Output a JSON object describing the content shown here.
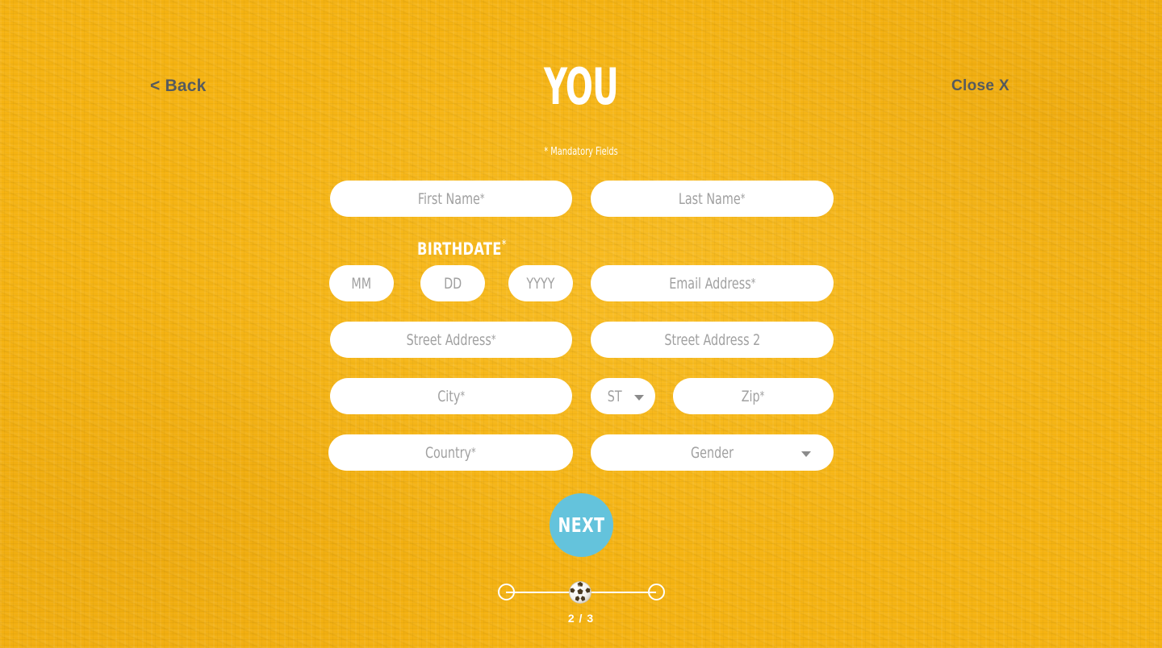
{
  "theme": {
    "background_color": "#f5b312",
    "field_background": "#ffffff",
    "placeholder_color": "#a0a0a0",
    "link_color": "#555a5e",
    "accent_color": "#64c3dc",
    "text_on_accent": "#ffffff"
  },
  "header": {
    "back_label": "< Back",
    "title": "YOU",
    "close_label": "Close X"
  },
  "form": {
    "mandatory_note": "* Mandatory Fields",
    "birthdate_label": "BIRTHDATE",
    "birthdate_star": "*",
    "fields": {
      "first_name": {
        "placeholder": "First Name",
        "value": "",
        "required": "*"
      },
      "last_name": {
        "placeholder": "Last Name",
        "value": "",
        "required": "*"
      },
      "birth_month": {
        "placeholder": "MM",
        "value": ""
      },
      "birth_day": {
        "placeholder": "DD",
        "value": ""
      },
      "birth_year": {
        "placeholder": "YYYY",
        "value": ""
      },
      "email": {
        "placeholder": "Email Address",
        "value": "",
        "required": "*"
      },
      "street_address": {
        "placeholder": "Street Address",
        "value": "",
        "required": "*"
      },
      "street_address_2": {
        "placeholder": "Street Address 2",
        "value": ""
      },
      "city": {
        "placeholder": "City",
        "value": "",
        "required": "*"
      },
      "state": {
        "selected": "ST",
        "value": ""
      },
      "zip": {
        "placeholder": "Zip",
        "value": "",
        "required": "*"
      },
      "country": {
        "placeholder": "Country",
        "value": "",
        "required": "*"
      },
      "gender": {
        "selected": "Gender",
        "value": ""
      }
    }
  },
  "actions": {
    "next_label": "NEXT"
  },
  "progress": {
    "current_step": 2,
    "total_steps": 3,
    "counter_label": "2 / 3",
    "marker_icon": "soccer-ball-icon"
  },
  "icons": {
    "state_caret": "chevron-down-icon",
    "gender_caret": "chevron-down-icon"
  }
}
